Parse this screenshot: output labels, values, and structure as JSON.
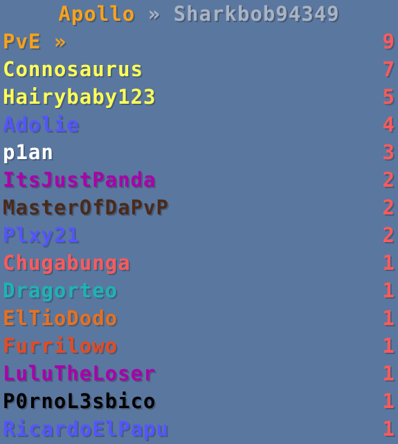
{
  "title": {
    "server": "Apollo",
    "separator": "»",
    "player": "Sharkbob94349",
    "server_color": "#f7a21b",
    "separator_color": "#a9b3c2",
    "player_color": "#a9b3c2"
  },
  "score_color": "#ff5a5a",
  "entries": [
    {
      "name": "PvE »",
      "score": "9",
      "color": "#f7a21b"
    },
    {
      "name": "Connosaurus",
      "score": "7",
      "color": "#ffff55"
    },
    {
      "name": "Hairybaby123",
      "score": "5",
      "color": "#ffff55"
    },
    {
      "name": "Adolie",
      "score": "4",
      "color": "#5555ff"
    },
    {
      "name": "p1an",
      "score": "3",
      "color": "#ffffff"
    },
    {
      "name": "ItsJustPanda",
      "score": "2",
      "color": "#aa00aa"
    },
    {
      "name": "MasterOfDaPvP",
      "score": "2",
      "color": "#4a2a1a"
    },
    {
      "name": "Plxy21",
      "score": "2",
      "color": "#5555ff"
    },
    {
      "name": "Chugabunga",
      "score": "1",
      "color": "#ff5a5a"
    },
    {
      "name": "Dragorteo",
      "score": "1",
      "color": "#1fb3b3"
    },
    {
      "name": "ElTioDodo",
      "score": "1",
      "color": "#e8701f"
    },
    {
      "name": "Furrilowo",
      "score": "1",
      "color": "#e84a1f"
    },
    {
      "name": "LuluTheLoser",
      "score": "1",
      "color": "#aa00aa"
    },
    {
      "name": "P0rnoL3sbico",
      "score": "1",
      "color": "#000000"
    },
    {
      "name": "RicardoElPapu",
      "score": "1",
      "color": "#5555ff"
    }
  ]
}
